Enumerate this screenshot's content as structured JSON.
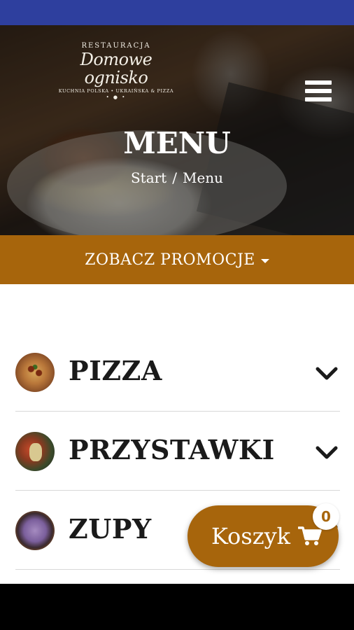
{
  "colors": {
    "status_bar": "#2e3f9e",
    "accent": "#a7650c",
    "text_dark": "#1a1a1a"
  },
  "header": {
    "logo": {
      "line1": "RESTAURACJA",
      "line2": "Domowe ognisko",
      "line3": "KUCHNIA POLSKA • UKRAIŃSKA & PIZZA",
      "dots": "• ● •"
    },
    "menu_icon": "hamburger-icon",
    "page_title": "MENU",
    "breadcrumb": {
      "home": "Start",
      "separator": "/",
      "current": "Menu"
    }
  },
  "promo": {
    "label": "ZOBACZ PROMOCJE",
    "icon": "caret-down-icon"
  },
  "categories": [
    {
      "name": "PIZZA",
      "icon": "chevron-down-icon"
    },
    {
      "name": "PRZYSTAWKI",
      "icon": "chevron-down-icon"
    },
    {
      "name": "ZUPY",
      "icon": "chevron-down-icon"
    }
  ],
  "cart": {
    "label": "Koszyk",
    "count": "0",
    "icon": "shopping-cart-icon"
  }
}
